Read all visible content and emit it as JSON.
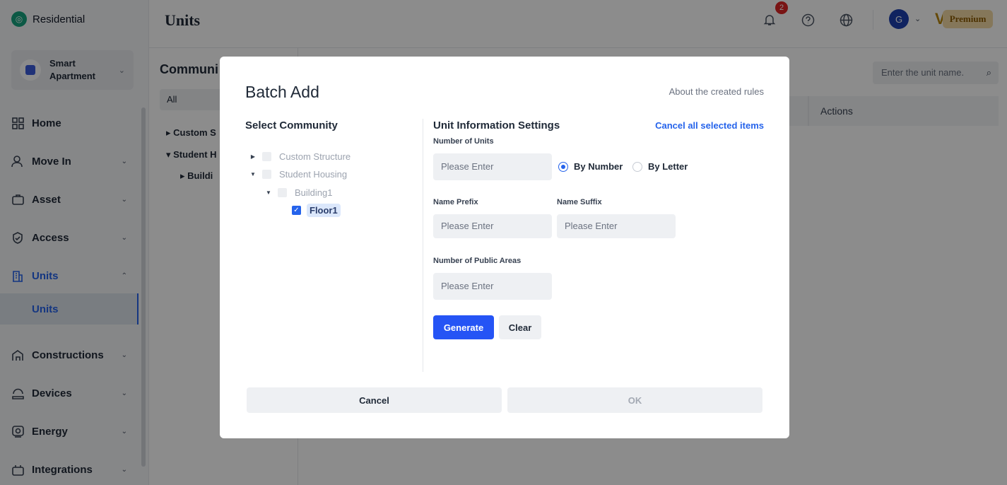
{
  "sidebar": {
    "brand": "Residential",
    "project_name": "Smart Apartment",
    "nav": [
      {
        "label": "Home",
        "icon": "home-grid-icon"
      },
      {
        "label": "Move In",
        "icon": "person-icon"
      },
      {
        "label": "Asset",
        "icon": "briefcase-icon"
      },
      {
        "label": "Access",
        "icon": "shield-icon"
      },
      {
        "label": "Units",
        "icon": "building-icon"
      },
      {
        "label": "Constructions",
        "icon": "construction-icon"
      },
      {
        "label": "Devices",
        "icon": "devices-icon"
      },
      {
        "label": "Energy",
        "icon": "energy-icon"
      },
      {
        "label": "Integrations",
        "icon": "integrations-icon"
      }
    ],
    "sub_item": "Units"
  },
  "header": {
    "title": "Units",
    "notification_count": "2",
    "avatar_letter": "G",
    "premium_label": "Premium"
  },
  "community_panel": {
    "title": "Communi",
    "all_label": "All",
    "tree": [
      "Custom S",
      "Student H",
      "Buildi"
    ]
  },
  "units_table": {
    "search_placeholder": "Enter the unit name.",
    "actions_header": "Actions"
  },
  "modal": {
    "title": "Batch Add",
    "about_link": "About the created rules",
    "left_title": "Select Community",
    "right_title": "Unit Information Settings",
    "cancel_all": "Cancel all selected items",
    "tree": {
      "custom": "Custom Structure",
      "student": "Student Housing",
      "building": "Building1",
      "floor": "Floor1"
    },
    "fields": {
      "num_units_label": "Number of Units",
      "num_units_placeholder": "Please Enter",
      "radio_number": "By Number",
      "radio_letter": "By Letter",
      "prefix_label": "Name Prefix",
      "prefix_placeholder": "Please Enter",
      "suffix_label": "Name Suffix",
      "suffix_placeholder": "Please Enter",
      "public_label": "Number of Public Areas",
      "public_placeholder": "Please Enter"
    },
    "generate": "Generate",
    "clear": "Clear",
    "cancel": "Cancel",
    "ok": "OK"
  }
}
